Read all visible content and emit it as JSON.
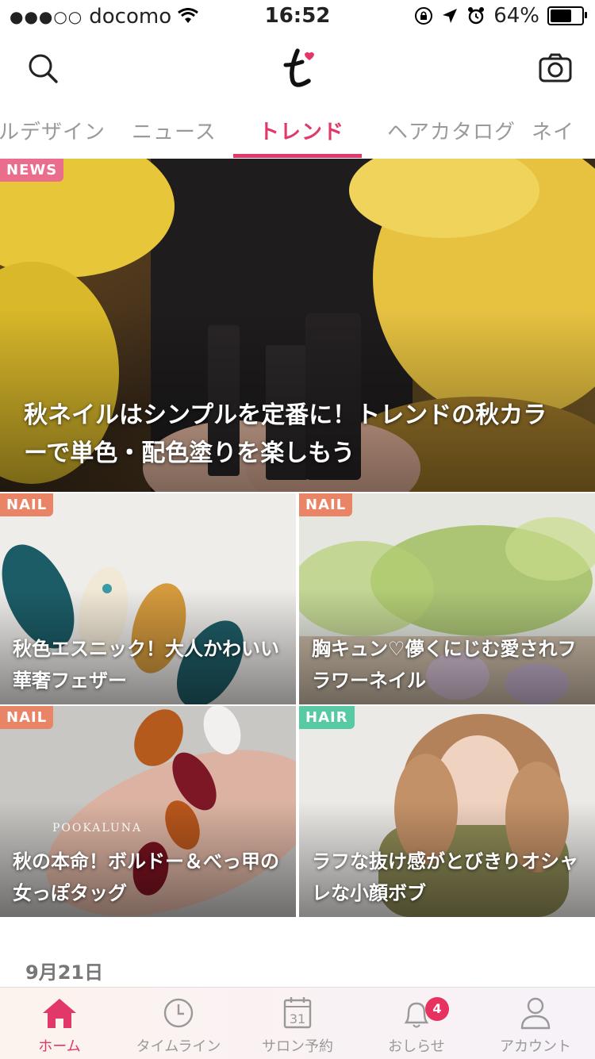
{
  "status_bar": {
    "signal_dots": "●●●○○",
    "carrier": "docomo",
    "time": "16:52",
    "battery_percent": "64%",
    "battery_level": 0.64
  },
  "header": {
    "search_icon": "search-icon",
    "logo_icon": "app-logo-icon",
    "camera_icon": "camera-icon"
  },
  "tabs": [
    {
      "label": "ルデザイン"
    },
    {
      "label": "ニュース"
    },
    {
      "label": "トレンド",
      "active": true
    },
    {
      "label": "ヘアカタログ"
    },
    {
      "label": "ネイ"
    }
  ],
  "featured": {
    "badge": "NEWS",
    "title": "秋ネイルはシンプルを定番に！トレンドの秋カラーで単色・配色塗りを楽しもう"
  },
  "grid": [
    {
      "badge": "NAIL",
      "title": "秋色エスニック！大人かわいい華奢フェザー"
    },
    {
      "badge": "NAIL",
      "title": "胸キュン♡儚くにじむ愛されフラワーネイル"
    },
    {
      "badge": "NAIL",
      "title": "秋の本命！ボルドー＆べっ甲の女っぽタッグ",
      "watermark": "POOKALUNA"
    },
    {
      "badge": "HAIR",
      "title": "ラフな抜け感がとびきりオシャレな小顔ボブ"
    }
  ],
  "date_heading": "9月21日",
  "tabbar": {
    "items": [
      {
        "label": "ホーム",
        "icon": "home-icon",
        "active": true
      },
      {
        "label": "タイムライン",
        "icon": "clock-icon"
      },
      {
        "label": "サロン予約",
        "icon": "calendar-icon",
        "icon_text": "31"
      },
      {
        "label": "おしらせ",
        "icon": "bell-icon",
        "badge": "4"
      },
      {
        "label": "アカウント",
        "icon": "person-icon"
      }
    ]
  },
  "colors": {
    "accent": "#e23868",
    "news_badge": "#ea6d8e",
    "nail_badge": "#e98467",
    "hair_badge": "#57c9a3"
  }
}
